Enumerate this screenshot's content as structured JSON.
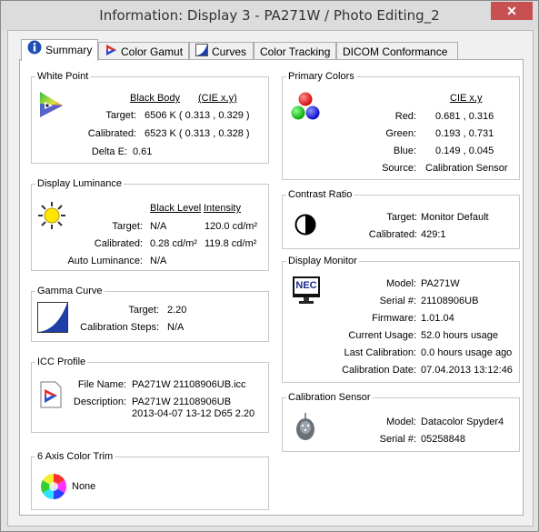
{
  "window": {
    "title": "Information: Display 3 - PA271W / Photo Editing_2",
    "close": "✕"
  },
  "tabs": [
    {
      "label": "Summary"
    },
    {
      "label": "Color Gamut"
    },
    {
      "label": "Curves"
    },
    {
      "label": "Color Tracking"
    },
    {
      "label": "DICOM Conformance"
    }
  ],
  "white_point": {
    "title": "White Point",
    "col_black_body": "Black Body",
    "col_cie": "(CIE x,y)",
    "target_label": "Target:",
    "target_value": "6506 K  ( 0.313 , 0.329 )",
    "calibrated_label": "Calibrated:",
    "calibrated_value": "6523 K  ( 0.313 , 0.328 )",
    "delta_label": "Delta E:",
    "delta_value": "0.61"
  },
  "luminance": {
    "title": "Display Luminance",
    "col_black": "Black Level",
    "col_intensity": "Intensity",
    "target_label": "Target:",
    "target_black": "N/A",
    "target_intensity": "120.0 cd/m²",
    "calibrated_label": "Calibrated:",
    "calibrated_black": "0.28 cd/m²",
    "calibrated_intensity": "119.8 cd/m²",
    "auto_label": "Auto Luminance:",
    "auto_value": "N/A"
  },
  "gamma": {
    "title": "Gamma Curve",
    "target_label": "Target:",
    "target_value": "2.20",
    "steps_label": "Calibration Steps:",
    "steps_value": "N/A"
  },
  "icc": {
    "title": "ICC Profile",
    "file_label": "File Name:",
    "file_value": "PA271W 21108906UB.icc",
    "desc_label": "Description:",
    "desc_line1": "PA271W 21108906UB",
    "desc_line2": "2013-04-07 13-12 D65 2.20"
  },
  "trim": {
    "title": "6 Axis Color Trim",
    "value": "None"
  },
  "primaries": {
    "title": "Primary Colors",
    "col_cie": "CIE x,y",
    "red_label": "Red:",
    "red_value": "0.681 , 0.316",
    "green_label": "Green:",
    "green_value": "0.193 , 0.731",
    "blue_label": "Blue:",
    "blue_value": "0.149 , 0.045",
    "source_label": "Source:",
    "source_value": "Calibration Sensor"
  },
  "contrast": {
    "title": "Contrast Ratio",
    "target_label": "Target:",
    "target_value": "Monitor Default",
    "calibrated_label": "Calibrated:",
    "calibrated_value": "429:1"
  },
  "monitor": {
    "title": "Display Monitor",
    "logo": "NEC",
    "model_label": "Model:",
    "model_value": "PA271W",
    "serial_label": "Serial #:",
    "serial_value": "21108906UB",
    "firmware_label": "Firmware:",
    "firmware_value": "1.01.04",
    "usage_label": "Current Usage:",
    "usage_value": "52.0 hours usage",
    "last_label": "Last Calibration:",
    "last_value": "0.0 hours usage ago",
    "date_label": "Calibration Date:",
    "date_value": "07.04.2013 13:12:46"
  },
  "sensor": {
    "title": "Calibration Sensor",
    "model_label": "Model:",
    "model_value": "Datacolor Spyder4",
    "serial_label": "Serial #:",
    "serial_value": "05258848"
  }
}
